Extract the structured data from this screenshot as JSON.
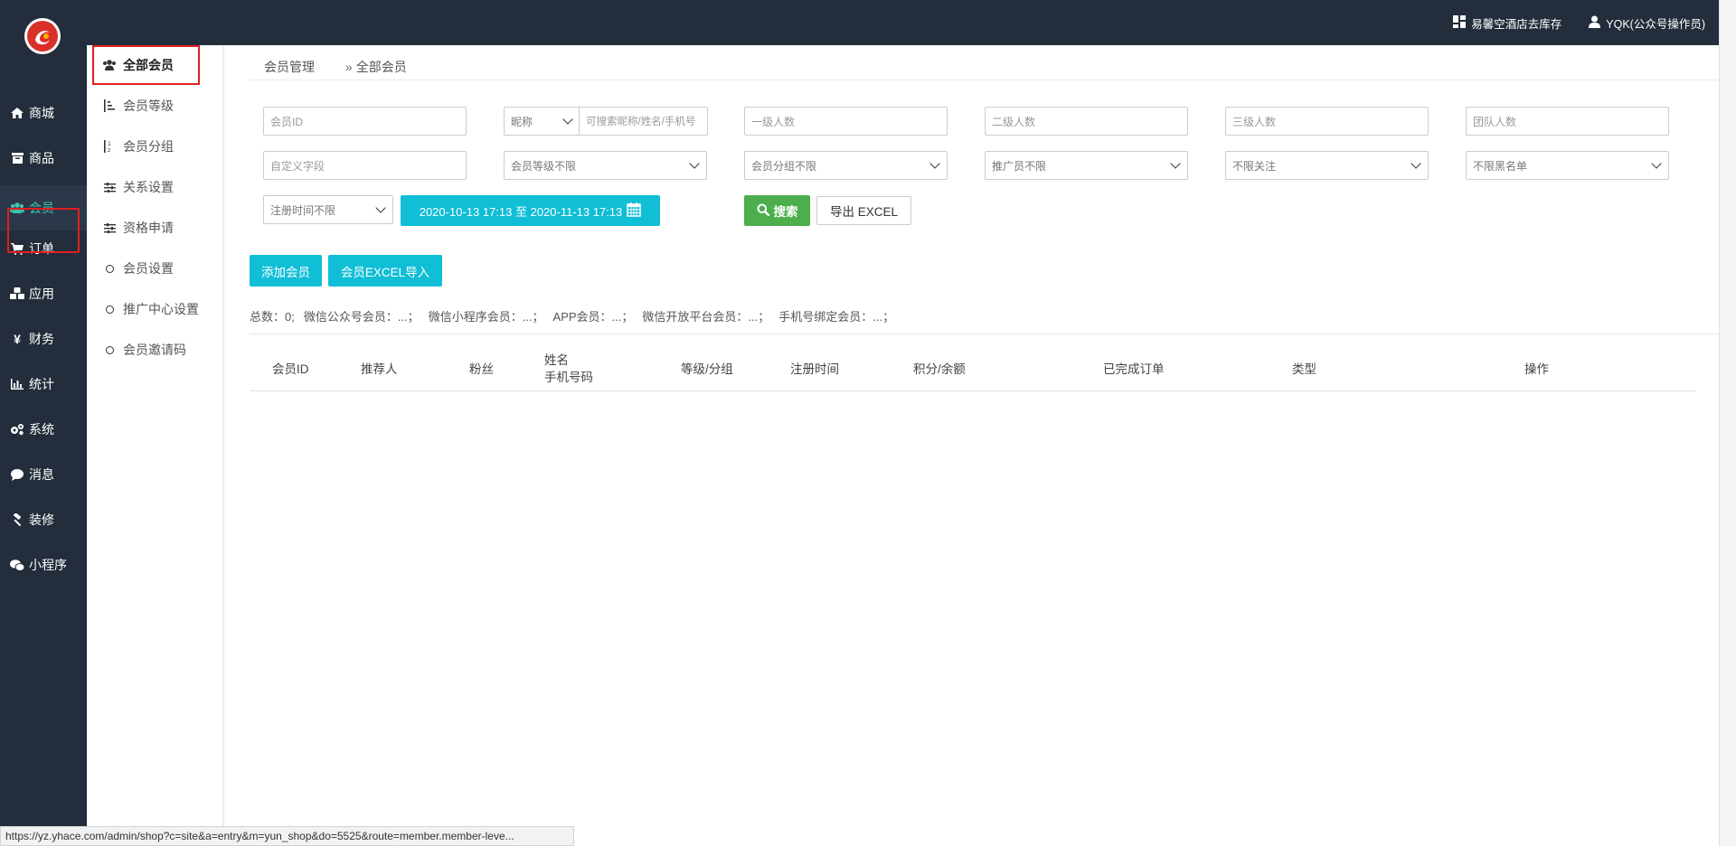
{
  "header": {
    "store_link": "易馨空酒店去库存",
    "user_label": "YQK(公众号操作员)"
  },
  "sidebar": {
    "items": [
      {
        "label": "商城",
        "icon": "home-icon"
      },
      {
        "label": "商品",
        "icon": "box-icon"
      },
      {
        "label": "会员",
        "icon": "users-icon",
        "active": true
      },
      {
        "label": "订单",
        "icon": "cart-icon"
      },
      {
        "label": "应用",
        "icon": "cubes-icon"
      },
      {
        "label": "财务",
        "icon": "yen-icon"
      },
      {
        "label": "统计",
        "icon": "bar-chart-icon"
      },
      {
        "label": "系统",
        "icon": "cogs-icon"
      },
      {
        "label": "消息",
        "icon": "comment-icon"
      },
      {
        "label": "装修",
        "icon": "gavel-icon"
      },
      {
        "label": "小程序",
        "icon": "wechat-icon"
      }
    ]
  },
  "subnav": {
    "items": [
      {
        "label": "全部会员",
        "icon": "users-icon",
        "active": true
      },
      {
        "label": "会员等级",
        "icon": "sort-amount-icon"
      },
      {
        "label": "会员分组",
        "icon": "sort-alpha-icon"
      },
      {
        "label": "关系设置",
        "icon": "sliders-icon"
      },
      {
        "label": "资格申请",
        "icon": "sliders-icon"
      },
      {
        "label": "会员设置",
        "icon": "circle-icon"
      },
      {
        "label": "推广中心设置",
        "icon": "circle-icon"
      },
      {
        "label": "会员邀请码",
        "icon": "circle-icon"
      }
    ]
  },
  "breadcrumb": {
    "parent": "会员管理",
    "separator": "»",
    "current": "全部会员"
  },
  "filters": {
    "member_id_placeholder": "会员ID",
    "nickname_select": "昵称",
    "nickname_search_placeholder": "可搜索昵称/姓名/手机号",
    "level1_placeholder": "一级人数",
    "level2_placeholder": "二级人数",
    "level3_placeholder": "三级人数",
    "team_placeholder": "团队人数",
    "custom_field_placeholder": "自定义字段",
    "member_level_select": "会员等级不限",
    "member_group_select": "会员分组不限",
    "promoter_select": "推广员不限",
    "follow_select": "不限关注",
    "blacklist_select": "不限黑名单",
    "register_time_select": "注册时间不限",
    "date_range": "2020-10-13 17:13 至 2020-11-13 17:13"
  },
  "actions": {
    "search": "搜索",
    "export": "导出 EXCEL",
    "add_member": "添加会员",
    "excel_import": "会员EXCEL导入"
  },
  "stats": {
    "total": "总数：0;",
    "wechat_official": "微信公众号会员：...；",
    "wechat_mini": "微信小程序会员：...；",
    "app": "APP会员：...；",
    "open_platform": "微信开放平台会员：...；",
    "phone_bound": "手机号绑定会员：...；"
  },
  "table": {
    "headers": {
      "member_id": "会员ID",
      "referrer": "推荐人",
      "fans": "粉丝",
      "name": "姓名",
      "phone": "手机号码",
      "level_group": "等级/分组",
      "register_time": "注册时间",
      "points_balance": "积分/余额",
      "completed_orders": "已完成订单",
      "type": "类型",
      "operation": "操作"
    }
  },
  "statusbar": {
    "url": "https://yz.yhace.com/admin/shop?c=site&a=entry&m=yun_shop&do=5525&route=member.member-leve..."
  },
  "colors": {
    "sidebar_bg": "#232d3b",
    "accent_cyan": "#10bed6",
    "search_green": "#4cae4c",
    "active_text": "#3bc6ae",
    "highlight_red": "#e02020"
  }
}
